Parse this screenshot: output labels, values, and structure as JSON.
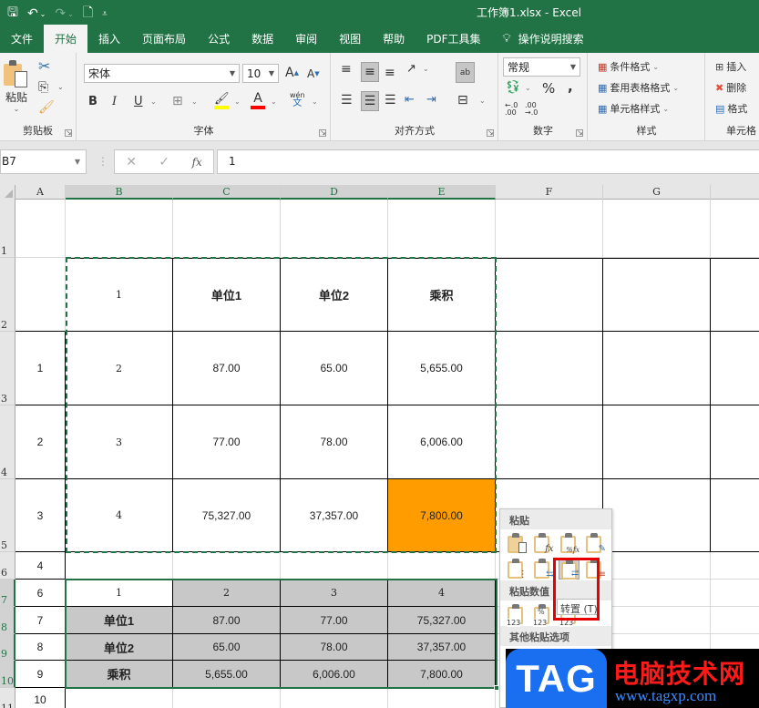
{
  "app": {
    "window_title": "工作簿1.xlsx  -  Excel",
    "quick_access": [
      {
        "name": "save-icon",
        "glyph": "🖫"
      },
      {
        "name": "undo-icon",
        "glyph": "↶"
      },
      {
        "name": "redo-icon",
        "glyph": "↷"
      },
      {
        "name": "print-preview-icon",
        "glyph": "🗋"
      },
      {
        "name": "customize-qat-icon",
        "glyph": "⩡"
      }
    ]
  },
  "ribbon_tabs": [
    {
      "label": "文件",
      "active": false
    },
    {
      "label": "开始",
      "active": true
    },
    {
      "label": "插入",
      "active": false
    },
    {
      "label": "页面布局",
      "active": false
    },
    {
      "label": "公式",
      "active": false
    },
    {
      "label": "数据",
      "active": false
    },
    {
      "label": "审阅",
      "active": false
    },
    {
      "label": "视图",
      "active": false
    },
    {
      "label": "帮助",
      "active": false
    },
    {
      "label": "PDF工具集",
      "active": false
    },
    {
      "label": "操作说明搜索",
      "active": false,
      "icon": "lightbulb-icon"
    }
  ],
  "ribbon": {
    "clipboard": {
      "label": "剪贴板",
      "paste_label": "粘贴"
    },
    "font": {
      "label": "字体",
      "font_name": "宋体",
      "font_size": "10",
      "bold": "B",
      "italic": "I",
      "underline": "U",
      "grow": "A",
      "shrink": "A",
      "phonetic_top": "wén",
      "phonetic_bottom": "文",
      "font_color_letter": "A"
    },
    "alignment": {
      "label": "对齐方式",
      "wrap": "ab"
    },
    "number": {
      "label": "数字",
      "format": "常规",
      "percent": "%",
      "comma": ",",
      "inc_decimal": "←.0 .00",
      "dec_decimal": ".00 →.0"
    },
    "styles": {
      "label": "样式",
      "conditional": "条件格式",
      "table": "套用表格格式",
      "cell_styles": "单元格样式"
    },
    "cells": {
      "label": "单元格",
      "insert": "插入",
      "delete": "删除",
      "format": "格式"
    }
  },
  "formula_bar": {
    "name_box": "B7",
    "cancel_glyph": "✕",
    "enter_glyph": "✓",
    "fx": "fx",
    "value": "1"
  },
  "grid": {
    "columns": [
      "A",
      "B",
      "C",
      "D",
      "E",
      "F",
      "G"
    ],
    "selected_columns": [
      "B",
      "C",
      "D",
      "E"
    ],
    "rows": [
      "1",
      "2",
      "3",
      "4",
      "5",
      "6",
      "7",
      "8",
      "9",
      "10",
      "11"
    ],
    "selected_rows": [
      "7",
      "8",
      "9",
      "10"
    ],
    "cells": {
      "B2": "1",
      "C2": "单位1",
      "D2": "单位2",
      "E2": "乘积",
      "A3": "1",
      "B3": "2",
      "C3": "87.00",
      "D3": "65.00",
      "E3": "5,655.00",
      "A4": "2",
      "B4": "3",
      "C4": "77.00",
      "D4": "78.00",
      "E4": "6,006.00",
      "A5": "3",
      "B5": "4",
      "C5": "75,327.00",
      "D5": "37,357.00",
      "E5": "7,800.00",
      "A6": "4",
      "A7": "6",
      "B7": "1",
      "C7": "2",
      "D7": "3",
      "E7": "4",
      "A8": "7",
      "B8": "单位1",
      "C8": "87.00",
      "D8": "77.00",
      "E8": "75,327.00",
      "A9": "8",
      "B9": "单位2",
      "C9": "65.00",
      "D9": "78.00",
      "E9": "37,357.00",
      "A10": "9",
      "B10": "乘积",
      "C10": "5,655.00",
      "D10": "6,006.00",
      "E10": "7,800.00",
      "A11": "10"
    },
    "highlight_color": "#ff9d00",
    "selection_color": "#217346"
  },
  "paste_menu": {
    "title": "粘贴",
    "values_title": "粘贴数值",
    "other_title": "其他粘贴选项",
    "tooltip": "转置 (T)",
    "paste_icons": [
      {
        "name": "paste-icon",
        "mark": ""
      },
      {
        "name": "paste-formulas-icon",
        "mark": "fx"
      },
      {
        "name": "paste-formulas-number-format-icon",
        "mark": "%fx"
      },
      {
        "name": "keep-source-formatting-icon",
        "mark": "✎"
      },
      {
        "name": "no-borders-icon",
        "mark": "⋮"
      },
      {
        "name": "keep-column-widths-icon",
        "mark": "⇆"
      },
      {
        "name": "transpose-icon",
        "mark": "⇄"
      },
      {
        "name": "paste-link-icon",
        "mark": "≡"
      }
    ],
    "value_icons": [
      {
        "name": "paste-values-icon",
        "label": "123",
        "mark": ""
      },
      {
        "name": "paste-values-number-format-icon",
        "label": "123",
        "mark": "%"
      },
      {
        "name": "paste-values-source-format-icon",
        "label": "123",
        "mark": "✎"
      }
    ]
  },
  "watermark": {
    "tag": "TAG",
    "site_name": "电脑技术网",
    "url": "www.tagxp.com"
  }
}
